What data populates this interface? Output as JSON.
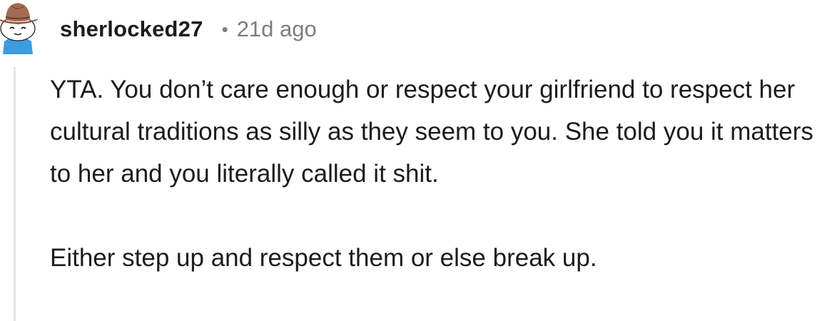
{
  "comment": {
    "username": "sherlocked27",
    "separator": "•",
    "timestamp": "21d ago",
    "avatar_icon": "cowboy-snoo-avatar-icon",
    "paragraphs": [
      "YTA. You don’t care enough or respect your girlfriend to respect her cultural traditions as silly as they seem to you. She told you it matters to her and you literally called it shit.",
      "Either step up and respect them or else break up."
    ]
  },
  "colors": {
    "text": "#1c1c1c",
    "meta": "#7c7c83",
    "thread_line": "#e5e5e6",
    "avatar_hat": "#a26b52",
    "avatar_shirt": "#3d9be0"
  }
}
